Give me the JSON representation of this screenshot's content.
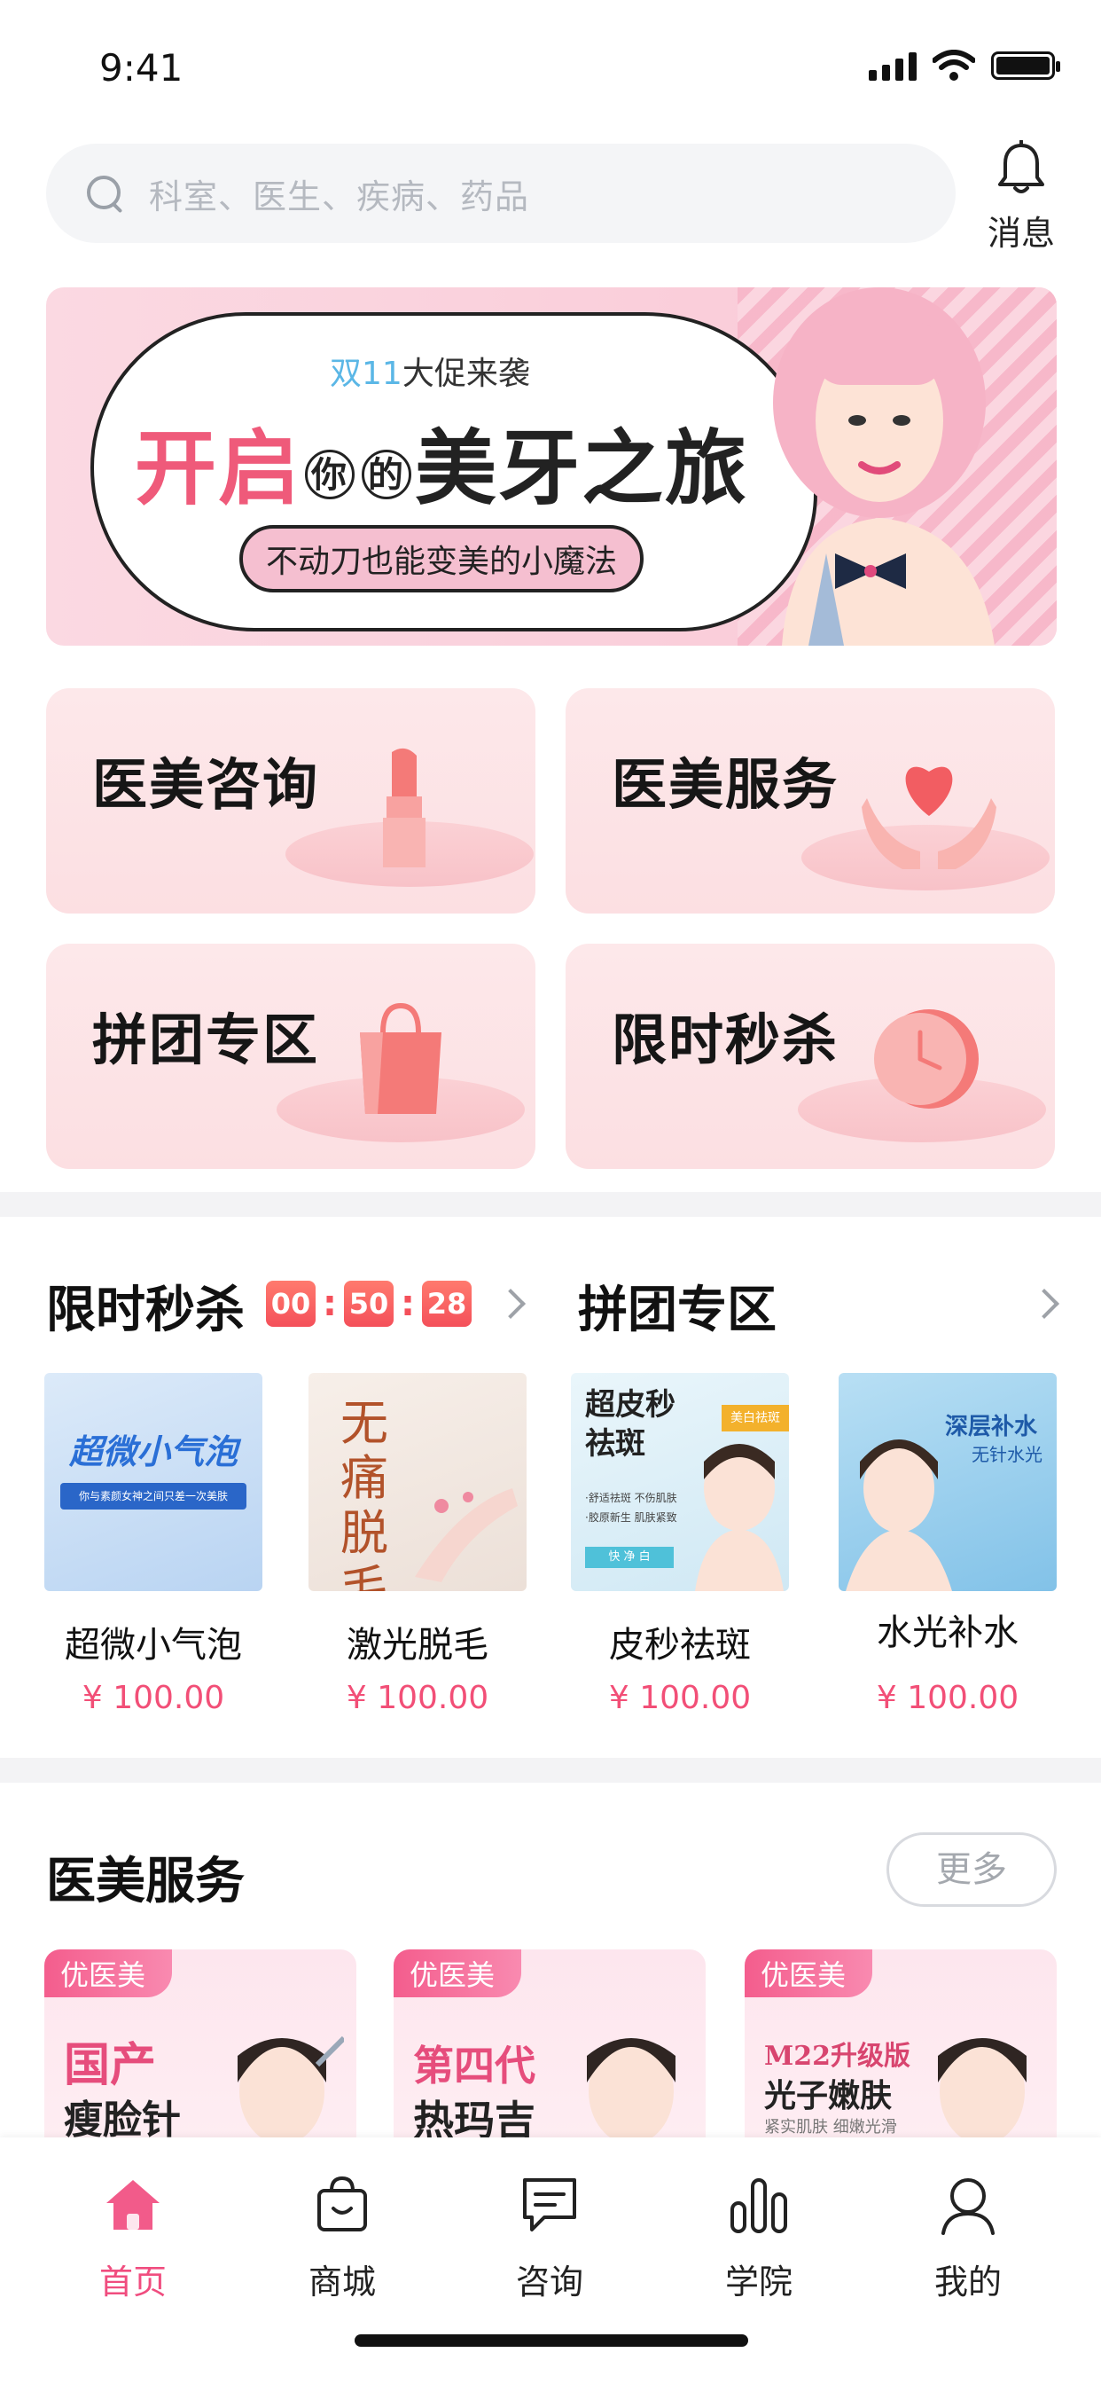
{
  "status_bar": {
    "time": "9:41"
  },
  "search": {
    "placeholder": "科室、医生、疾病、药品"
  },
  "messages": {
    "label": "消息"
  },
  "banner": {
    "top_highlight": "双11",
    "top_text": "大促来袭",
    "main_pink": "开启",
    "main_small_1": "你",
    "main_small_2": "的",
    "main_dark": "美牙之旅",
    "pill": "不动刀也能变美的小魔法"
  },
  "categories": [
    {
      "label": "医美咨询",
      "icon": "lipstick-icon"
    },
    {
      "label": "医美服务",
      "icon": "heart-hands-icon"
    },
    {
      "label": "拼团专区",
      "icon": "shopping-bag-icon"
    },
    {
      "label": "限时秒杀",
      "icon": "clock-icon"
    }
  ],
  "flash_sale": {
    "title": "限时秒杀",
    "countdown": {
      "h": "00",
      "m": "50",
      "s": "28"
    }
  },
  "group_buy": {
    "title": "拼团专区"
  },
  "products": [
    {
      "name": "超微小气泡",
      "price": "¥ 100.00",
      "img_title": "超微小气泡",
      "img_sub": "你与素颜女神之间只差一次美肤"
    },
    {
      "name": "激光脱毛",
      "price": "¥ 100.00",
      "img_title": "无痛脱毛"
    },
    {
      "name": "皮秒祛斑",
      "price": "¥ 100.00",
      "img_title": "超皮秒祛斑",
      "img_tag": "美白祛斑",
      "img_lines": [
        "·舒适祛斑 不伤肌肤",
        "·胶原新生 肌肤紧致"
      ],
      "img_footer": "快 净 白"
    },
    {
      "name": "水光补水",
      "price": "¥ 100.00",
      "img_title": "深层补水",
      "img_sub": "无针水光"
    }
  ],
  "services": {
    "title": "医美服务",
    "more": "更多",
    "items": [
      {
        "badge": "优医美",
        "line1": "国产",
        "line2": "瘦脸针"
      },
      {
        "badge": "优医美",
        "line1": "第四代",
        "line2": "热玛吉"
      },
      {
        "badge": "优医美",
        "line1": "M22升级版",
        "line2": "光子嫩肤",
        "line3": "紧实肌肤 细嫩光滑"
      }
    ]
  },
  "tabbar": {
    "items": [
      {
        "label": "首页",
        "icon": "home-icon",
        "active": true
      },
      {
        "label": "商城",
        "icon": "shop-bag-icon",
        "active": false
      },
      {
        "label": "咨询",
        "icon": "chat-icon",
        "active": false
      },
      {
        "label": "学院",
        "icon": "bar-chart-icon",
        "active": false
      },
      {
        "label": "我的",
        "icon": "user-icon",
        "active": false
      }
    ]
  },
  "colors": {
    "accent": "#f04d7f",
    "price": "#f24f77",
    "countdown": "#f4505a",
    "tile_bg": "#fde8ea"
  }
}
